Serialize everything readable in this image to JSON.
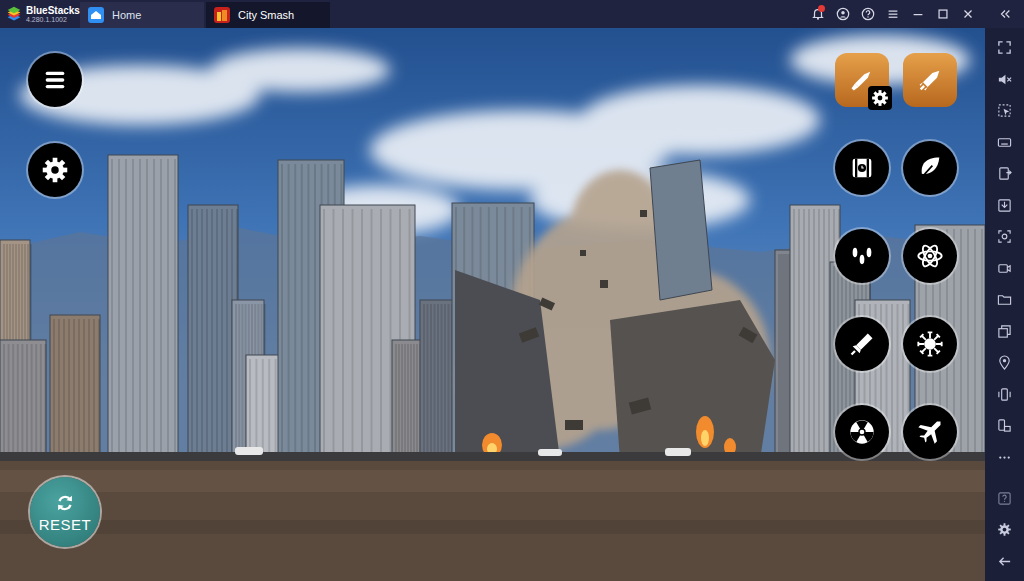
{
  "window": {
    "brand": "BlueStacks",
    "version": "4.280.1.1002"
  },
  "tabs": [
    {
      "label": "Home",
      "selected": false
    },
    {
      "label": "City Smash",
      "selected": true
    }
  ],
  "notifications": {
    "badge": true
  },
  "game": {
    "reset_button": "RESET"
  }
}
